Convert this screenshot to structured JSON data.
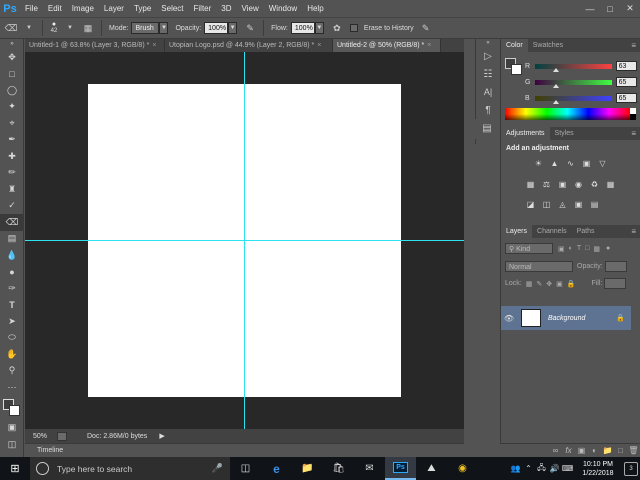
{
  "app": {
    "logo": "Ps"
  },
  "menu": [
    "File",
    "Edit",
    "Image",
    "Layer",
    "Type",
    "Select",
    "Filter",
    "3D",
    "View",
    "Window",
    "Help"
  ],
  "options": {
    "brush_size": "42",
    "mode_label": "Mode:",
    "mode_value": "Brush",
    "opacity_label": "Opacity:",
    "opacity_value": "100%",
    "flow_label": "Flow:",
    "flow_value": "100%",
    "erase_history_label": "Erase to History"
  },
  "tabs": [
    {
      "label": "Untitled-1 @ 63.8% (Layer 3, RGB/8) *",
      "active": false
    },
    {
      "label": "Utopian Logo.psd @ 44.9% (Layer 2, RGB/8) *",
      "active": false
    },
    {
      "label": "Untitled-2 @ 50% (RGB/8) *",
      "active": true
    }
  ],
  "status": {
    "zoom": "50%",
    "doc_info": "Doc: 2.86M/0 bytes",
    "timeline_label": "Timeline"
  },
  "color_panel": {
    "tabs": [
      "Color",
      "Swatches"
    ],
    "r_label": "R",
    "r_value": "63",
    "g_label": "G",
    "g_value": "65",
    "b_label": "B",
    "b_value": "65",
    "fg_color": "#3f4141",
    "bg_color": "#ffffff"
  },
  "adjustments_panel": {
    "tabs": [
      "Adjustments",
      "Styles"
    ],
    "title": "Add an adjustment"
  },
  "layers_panel": {
    "tabs": [
      "Layers",
      "Channels",
      "Paths"
    ],
    "kind_label": "Kind",
    "blend_mode": "Normal",
    "opacity_label": "Opacity:",
    "lock_label": "Lock:",
    "fill_label": "Fill:",
    "layers": [
      {
        "name": "Background",
        "visible": true,
        "locked": true
      }
    ]
  },
  "taskbar": {
    "search_placeholder": "Type here to search",
    "time": "10:10 PM",
    "date": "1/22/2018",
    "notification_count": "3"
  },
  "colors": {
    "guide": "#2ee3f0",
    "layer_selected": "#5e7391",
    "workspace": "#282828",
    "panel": "#535353"
  }
}
